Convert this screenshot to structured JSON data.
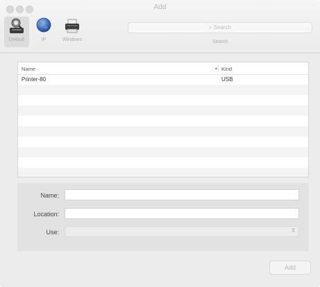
{
  "window": {
    "title": "Add"
  },
  "toolbar": {
    "items": [
      {
        "label": "Default",
        "icon": "default-printer-icon",
        "selected": true
      },
      {
        "label": "IP",
        "icon": "globe-icon",
        "selected": false
      },
      {
        "label": "Windows",
        "icon": "printer-icon",
        "selected": false
      }
    ],
    "search_placeholder": "Search",
    "search_label": "Search"
  },
  "table": {
    "columns": {
      "name": "Name",
      "kind": "Kind"
    },
    "rows": [
      {
        "name": "Printer-80",
        "kind": "USB"
      }
    ]
  },
  "form": {
    "name_label": "Name:",
    "name_value": "",
    "location_label": "Location:",
    "location_value": "",
    "use_label": "Use:",
    "use_value": ""
  },
  "buttons": {
    "add": "Add"
  },
  "colors": {
    "window_bg": "#ececec",
    "disabled_text": "#b8b8b8"
  }
}
